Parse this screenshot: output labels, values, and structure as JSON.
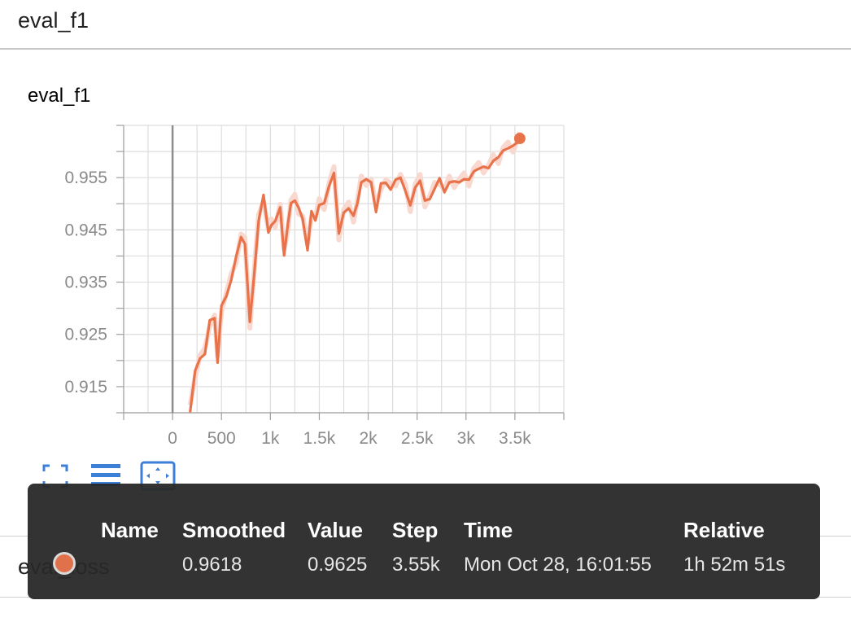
{
  "section": {
    "title": "eval_f1"
  },
  "card": {
    "title": "eval_f1"
  },
  "colors": {
    "line": "#e8734a",
    "band": "#f8d8cf",
    "grid": "#dddddd",
    "axis": "#9e9e9e",
    "accent": "#3b7fd6"
  },
  "toolbar": {
    "icons": [
      "fullscreen-icon",
      "list-icon",
      "fit-domain-icon"
    ]
  },
  "next_section": {
    "label": "eval_loss"
  },
  "chart_data": {
    "type": "line",
    "title": "",
    "xlabel": "",
    "ylabel": "",
    "xlim": [
      -500,
      4000
    ],
    "ylim": [
      0.91,
      0.965
    ],
    "xticks": [
      0,
      500,
      1000,
      1500,
      2000,
      2500,
      3000,
      3500
    ],
    "xtick_labels": [
      "0",
      "500",
      "1k",
      "1.5k",
      "2k",
      "2.5k",
      "3k",
      "3.5k"
    ],
    "yticks": [
      0.915,
      0.925,
      0.935,
      0.945,
      0.955
    ],
    "ytick_labels": [
      "0.915",
      "0.925",
      "0.935",
      "0.945",
      "0.955"
    ],
    "grid": true,
    "series": [
      {
        "x": [
          180,
          230,
          280,
          330,
          380,
          430,
          460,
          500,
          550,
          600,
          650,
          700,
          740,
          790,
          830,
          880,
          930,
          980,
          1010,
          1050,
          1100,
          1140,
          1180,
          1210,
          1250,
          1290,
          1330,
          1380,
          1420,
          1460,
          1500,
          1550,
          1600,
          1650,
          1700,
          1750,
          1800,
          1850,
          1890,
          1930,
          1980,
          2030,
          2080,
          2130,
          2180,
          2230,
          2280,
          2330,
          2380,
          2430,
          2480,
          2530,
          2580,
          2630,
          2680,
          2730,
          2780,
          2830,
          2880,
          2930,
          2980,
          3030,
          3080,
          3130,
          3180,
          3230,
          3280,
          3330,
          3380,
          3430,
          3480,
          3530,
          3550
        ],
        "values": [
          0.9103,
          0.918,
          0.9204,
          0.9212,
          0.9277,
          0.9281,
          0.9196,
          0.9305,
          0.9323,
          0.9354,
          0.9399,
          0.9436,
          0.9423,
          0.9274,
          0.9355,
          0.9467,
          0.9517,
          0.9445,
          0.9459,
          0.9467,
          0.9493,
          0.9401,
          0.9463,
          0.9501,
          0.9506,
          0.9492,
          0.9471,
          0.9411,
          0.9486,
          0.9468,
          0.9498,
          0.9501,
          0.9534,
          0.9559,
          0.9443,
          0.9483,
          0.9491,
          0.9477,
          0.9501,
          0.9541,
          0.9547,
          0.9541,
          0.9484,
          0.9539,
          0.954,
          0.9527,
          0.9546,
          0.955,
          0.9525,
          0.9497,
          0.9531,
          0.9544,
          0.9506,
          0.9509,
          0.9529,
          0.9549,
          0.9522,
          0.9541,
          0.9543,
          0.9541,
          0.9547,
          0.9546,
          0.9562,
          0.9567,
          0.9571,
          0.9568,
          0.9582,
          0.9589,
          0.9602,
          0.9606,
          0.9611,
          0.9618,
          0.9625
        ]
      }
    ]
  },
  "tooltip": {
    "headers": [
      "Name",
      "Smoothed",
      "Value",
      "Step",
      "Time",
      "Relative"
    ],
    "row": {
      "name": "",
      "smoothed": "0.9618",
      "value": "0.9625",
      "step": "3.55k",
      "time": "Mon Oct 28, 16:01:55",
      "relative": "1h 52m 51s"
    }
  }
}
